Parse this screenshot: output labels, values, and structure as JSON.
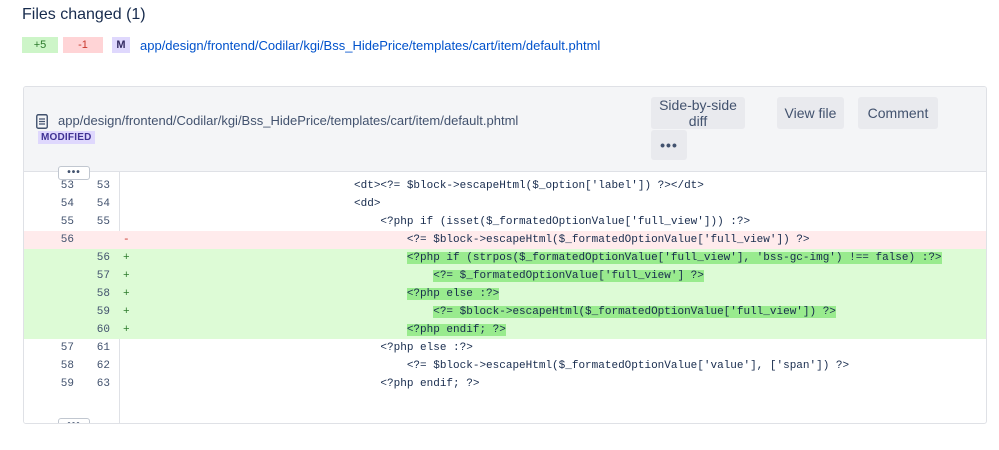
{
  "page": {
    "title": "Files changed (1)"
  },
  "summary": {
    "added": "+5",
    "removed": "-1",
    "status_letter": "M",
    "file_path": "app/design/frontend/Codilar/kgi/Bss_HidePrice/templates/cart/item/default.phtml"
  },
  "file": {
    "path": "app/design/frontend/Codilar/kgi/Bss_HidePrice/templates/cart/item/default.phtml",
    "status": "MODIFIED",
    "icon": "file-document-icon",
    "buttons": {
      "side_by_side": "Side-by-side diff",
      "view_file": "View file",
      "comment": "Comment",
      "more": "•••"
    },
    "expand_label": "•••"
  },
  "diff": {
    "lines": [
      {
        "type": "context",
        "old": "53",
        "new": "53",
        "marker": "",
        "indent": "          ",
        "text": "<dt><?= $block->escapeHtml($_option['label']) ?></dt>"
      },
      {
        "type": "context",
        "old": "54",
        "new": "54",
        "marker": "",
        "indent": "          ",
        "text": "<dd>"
      },
      {
        "type": "context",
        "old": "55",
        "new": "55",
        "marker": "",
        "indent": "              ",
        "text": "<?php if (isset($_formatedOptionValue['full_view'])) :?>"
      },
      {
        "type": "del",
        "old": "56",
        "new": "",
        "marker": "-",
        "indent": "                  ",
        "text": "<?= $block->escapeHtml($_formatedOptionValue['full_view']) ?>"
      },
      {
        "type": "add",
        "old": "",
        "new": "56",
        "marker": "+",
        "indent": "                  ",
        "text": "<?php if (strpos($_formatedOptionValue['full_view'], 'bss-gc-img') !== false) :?>"
      },
      {
        "type": "add",
        "old": "",
        "new": "57",
        "marker": "+",
        "indent": "                      ",
        "text": "<?= $_formatedOptionValue['full_view'] ?>"
      },
      {
        "type": "add",
        "old": "",
        "new": "58",
        "marker": "+",
        "indent": "                  ",
        "text": "<?php else :?>"
      },
      {
        "type": "add",
        "old": "",
        "new": "59",
        "marker": "+",
        "indent": "                      ",
        "text": "<?= $block->escapeHtml($_formatedOptionValue['full_view']) ?>"
      },
      {
        "type": "add",
        "old": "",
        "new": "60",
        "marker": "+",
        "indent": "                  ",
        "text": "<?php endif; ?>"
      },
      {
        "type": "context",
        "old": "57",
        "new": "61",
        "marker": "",
        "indent": "              ",
        "text": "<?php else :?>"
      },
      {
        "type": "context",
        "old": "58",
        "new": "62",
        "marker": "",
        "indent": "                  ",
        "text": "<?= $block->escapeHtml($_formatedOptionValue['value'], ['span']) ?>"
      },
      {
        "type": "context",
        "old": "59",
        "new": "63",
        "marker": "",
        "indent": "              ",
        "text": "<?php endif; ?>"
      }
    ]
  },
  "colors": {
    "link": "#0052cc",
    "added_bg": "#ddfbd6",
    "added_highlight": "#99eb8e",
    "removed_bg": "#ffebec",
    "modified_lozenge": "#dfd8fd"
  }
}
